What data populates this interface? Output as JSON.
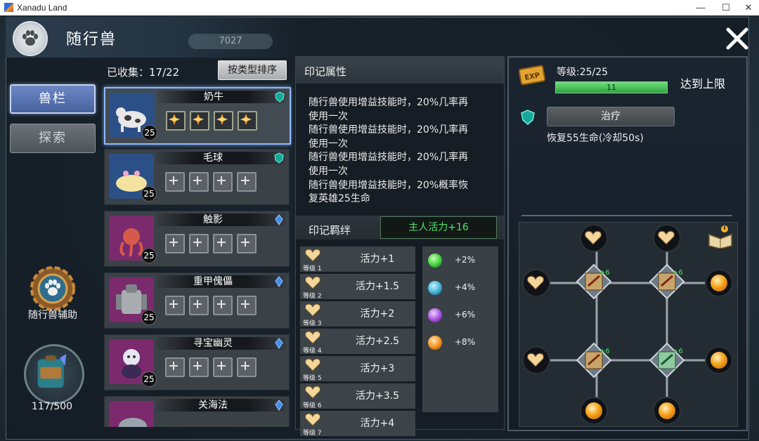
{
  "window": {
    "title": "Xanadu Land",
    "minimize": "—",
    "maximize": "☐",
    "close": "✕"
  },
  "header": {
    "title": "随行兽",
    "bg_chip": "7027"
  },
  "left_tabs": {
    "active": "兽栏",
    "inactive": "探索"
  },
  "assist": {
    "label": "随行兽辅助"
  },
  "bag": {
    "count": "117/500"
  },
  "list": {
    "collected": "已收集：17/22",
    "sort_label": "按类型排序",
    "pets": [
      {
        "name": "奶牛",
        "level": "25",
        "gem": "teal-shield",
        "slots_filled": 4
      },
      {
        "name": "毛球",
        "level": "25",
        "gem": "teal-shield",
        "slots_filled": 0
      },
      {
        "name": "触影",
        "level": "25",
        "gem": "blue-crystal",
        "slots_filled": 0
      },
      {
        "name": "重甲傀儡",
        "level": "25",
        "gem": "blue-crystal",
        "slots_filled": 0
      },
      {
        "name": "寻宝幽灵",
        "level": "25",
        "gem": "blue-crystal",
        "slots_filled": 0
      },
      {
        "name": "关海法",
        "level": "",
        "gem": "blue-crystal",
        "slots_filled": 0
      }
    ]
  },
  "seal": {
    "title": "印记属性",
    "description": [
      "随行兽使用增益技能时，20%几率再",
      "使用一次",
      "随行兽使用增益技能时，20%几率再",
      "使用一次",
      "随行兽使用增益技能时，20%几率再",
      "使用一次",
      "随行兽使用增益技能时，20%概率恢",
      "复英雄25生命"
    ],
    "bond_title": "印记羁绊",
    "bond_bonus": "主人活力+16",
    "levels": [
      {
        "label": "等级 1",
        "bonus": "活力+1"
      },
      {
        "label": "等级 2",
        "bonus": "活力+1.5"
      },
      {
        "label": "等级 3",
        "bonus": "活力+2"
      },
      {
        "label": "等级 4",
        "bonus": "活力+2.5"
      },
      {
        "label": "等级 5",
        "bonus": "活力+3"
      },
      {
        "label": "等级 6",
        "bonus": "活力+3.5"
      },
      {
        "label": "等级 7",
        "bonus": "活力+4"
      }
    ],
    "orbs": [
      {
        "color": "#3fcf3a",
        "pct": "+2%"
      },
      {
        "color": "#3fb0d6",
        "pct": "+4%"
      },
      {
        "color": "#a64fe0",
        "pct": "+6%"
      },
      {
        "color": "#f0901a",
        "pct": "+8%"
      }
    ]
  },
  "detail": {
    "level_label": "等级:25/25",
    "exp_value": "11",
    "exp_fraction": 1.0,
    "max_text": "达到上限",
    "skill_name": "治疗",
    "skill_desc": "恢复55生命(冷却50s)",
    "socket_label": "+6"
  },
  "colors": {
    "accent_green": "#4fe06a",
    "tab_active": "#5873b3",
    "orb_gold": "#f7a31a"
  }
}
